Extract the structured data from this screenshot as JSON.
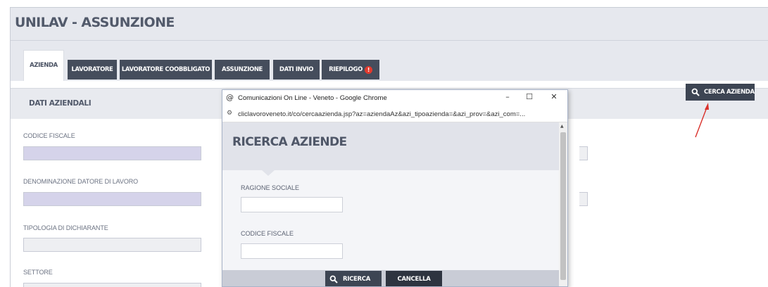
{
  "app": {
    "title": "UNILAV - ASSUNZIONE"
  },
  "tabs": [
    {
      "label": "AZIENDA",
      "active": true
    },
    {
      "label": "LAVORATORE",
      "active": false
    },
    {
      "label": "LAVORATORE COOBBLIGATO",
      "active": false
    },
    {
      "label": "ASSUNZIONE",
      "active": false
    },
    {
      "label": "DATI INVIO",
      "active": false
    },
    {
      "label": "RIEPILOGO",
      "active": false,
      "badge": "!"
    }
  ],
  "section": {
    "title": "DATI AZIENDALI",
    "search_button": "CERCA AZIENDA"
  },
  "fields": [
    {
      "label": "CODICE FISCALE",
      "value": ""
    },
    {
      "label": "DENOMINAZIONE DATORE DI LAVORO",
      "value": ""
    },
    {
      "label": "TIPOLOGIA DI DICHIARANTE",
      "value": ""
    },
    {
      "label": "SETTORE",
      "value": ""
    }
  ],
  "popup": {
    "window_title": "Comunicazioni On Line - Veneto - Google Chrome",
    "url": "cliclavoroveneto.it/co/cercaazienda.jsp?az=aziendaAz&azi_tipoazienda=&azi_prov=&azi_com=...",
    "heading": "RICERCA AZIENDE",
    "fields": [
      {
        "label": "RAGIONE SOCIALE",
        "value": ""
      },
      {
        "label": "CODICE FISCALE",
        "value": ""
      }
    ],
    "buttons": {
      "search": "RICERCA",
      "cancel": "CANCELLA"
    }
  },
  "colors": {
    "dark_button": "#3d4553",
    "purple_field": "#d5d3ea",
    "annotation_arrow": "#d9302a",
    "warning": "#e23a2e"
  }
}
